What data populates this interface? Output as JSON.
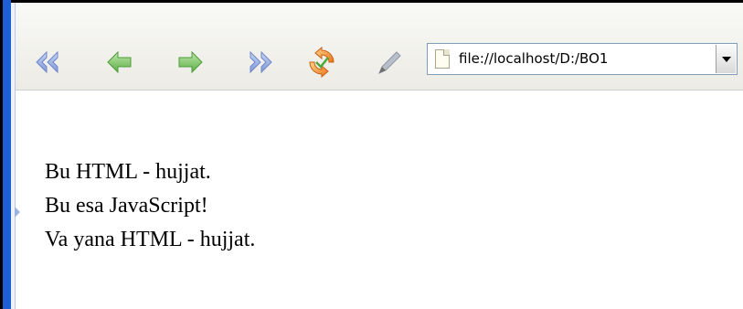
{
  "toolbar": {
    "buttons": [
      {
        "name": "back-all-button",
        "icon": "double-left-arrow-icon"
      },
      {
        "name": "back-button",
        "icon": "left-arrow-icon"
      },
      {
        "name": "forward-button",
        "icon": "right-arrow-icon"
      },
      {
        "name": "forward-all-button",
        "icon": "double-right-arrow-icon"
      },
      {
        "name": "refresh-button",
        "icon": "refresh-icon"
      },
      {
        "name": "edit-button",
        "icon": "pencil-icon"
      }
    ],
    "address": {
      "value": "file://localhost/D:/BO1",
      "icon": "page-icon"
    }
  },
  "page": {
    "lines": [
      "Bu HTML - hujjat.",
      "Bu esa JavaScript!",
      "Va yana HTML - hujjat."
    ]
  },
  "colors": {
    "rail": "#1f5fd6",
    "arrow_blue": "#8fa6e0",
    "arrow_green": "#62b552",
    "refresh_orange": "#f08a1c"
  }
}
